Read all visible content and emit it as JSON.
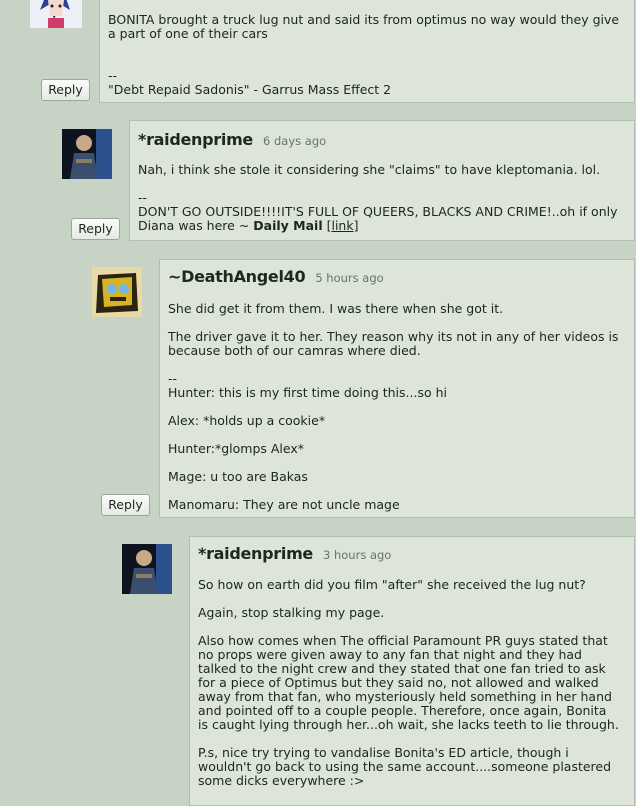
{
  "comments": [
    {
      "body": "BONITA brought a truck lug nut and said its from optimus no way would they give\na part of one of their cars",
      "sig_sep": "--",
      "sig": "\"Debt Repaid Sadonis\" - Garrus Mass Effect 2",
      "reply_label": "Reply"
    },
    {
      "author": "*raidenprime",
      "time": "6 days ago",
      "body": "Nah, i think she stole it considering she \"claims\" to have kleptomania. lol.",
      "sig_sep": "--",
      "sig_line1": "DON'T GO OUTSIDE!!!!IT'S FULL OF QUEERS, BLACKS AND CRIME!..oh if only",
      "sig_line2_prefix": "Diana was here ~ ",
      "sig_bold": "Daily Mail",
      "sig_link": "[link]",
      "reply_label": "Reply"
    },
    {
      "author": "~DeathAngel40",
      "time": "5 hours ago",
      "body1": "She did get it from them. I was there when she got it.",
      "body2": "The driver gave it to her. They reason why its not in any of her videos is\nbecause both of our camras where died.",
      "sig_sep": "--",
      "sig_lines": [
        "Hunter: this is my first time doing this...so hi",
        "Alex: *holds up a cookie*",
        "Hunter:*glomps Alex*",
        "Mage: u too are Bakas",
        "Manomaru: They are not uncle mage"
      ],
      "reply_label": "Reply"
    },
    {
      "author": "*raidenprime",
      "time": "3 hours ago",
      "p1": "So how on earth did you film \"after\" she received the lug nut?",
      "p2": "Again, stop stalking my page.",
      "p3": "Also how comes when The official Paramount PR guys stated that\nno props were given away to any fan that night and they had\ntalked to the night crew and they stated that one fan tried to ask\nfor a piece of Optimus but they said no, not allowed and walked\naway from that fan, who mysteriously held something in her hand\nand pointed off to a couple people. Therefore, once again, Bonita\nis caught lying through her...oh wait, she lacks teeth to lie through.",
      "p4": "P.s, nice try trying to vandalise Bonita's ED article, though i\nwouldn't go back to using the same account....someone plastered\nsome dicks everywhere :>"
    }
  ]
}
